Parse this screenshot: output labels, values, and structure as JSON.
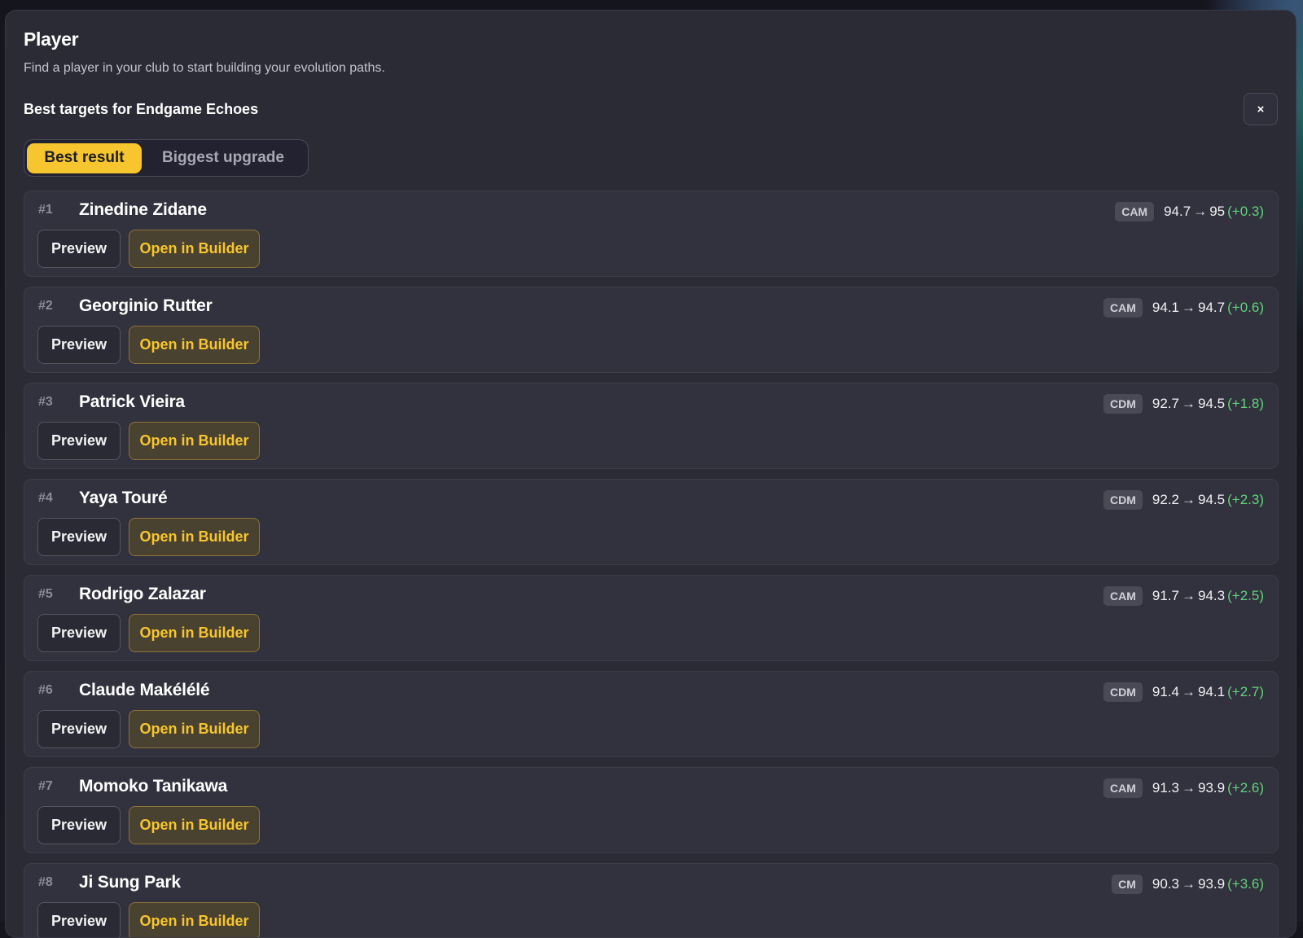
{
  "header": {
    "title": "Player",
    "subtitle": "Find a player in your club to start building your evolution paths.",
    "section_heading": "Best targets for Endgame Echoes",
    "close_label": "×"
  },
  "toggle": {
    "options": [
      "Best result",
      "Biggest upgrade"
    ],
    "selected": "Best result"
  },
  "actions": {
    "preview_label": "Preview",
    "builder_label": "Open in Builder",
    "arrow_glyph": "→"
  },
  "colors": {
    "accent": "#f7c52e",
    "delta_positive": "#5fd37a",
    "panel": "#2b2b36"
  },
  "players": [
    {
      "rank": "#1",
      "name": "Zinedine Zidane",
      "position": "CAM",
      "from": "94.7",
      "to": "95",
      "delta": "(+0.3)"
    },
    {
      "rank": "#2",
      "name": "Georginio Rutter",
      "position": "CAM",
      "from": "94.1",
      "to": "94.7",
      "delta": "(+0.6)"
    },
    {
      "rank": "#3",
      "name": "Patrick Vieira",
      "position": "CDM",
      "from": "92.7",
      "to": "94.5",
      "delta": "(+1.8)"
    },
    {
      "rank": "#4",
      "name": "Yaya Touré",
      "position": "CDM",
      "from": "92.2",
      "to": "94.5",
      "delta": "(+2.3)"
    },
    {
      "rank": "#5",
      "name": "Rodrigo Zalazar",
      "position": "CAM",
      "from": "91.7",
      "to": "94.3",
      "delta": "(+2.5)"
    },
    {
      "rank": "#6",
      "name": "Claude Makélélé",
      "position": "CDM",
      "from": "91.4",
      "to": "94.1",
      "delta": "(+2.7)"
    },
    {
      "rank": "#7",
      "name": "Momoko Tanikawa",
      "position": "CAM",
      "from": "91.3",
      "to": "93.9",
      "delta": "(+2.6)"
    },
    {
      "rank": "#8",
      "name": "Ji Sung Park",
      "position": "CM",
      "from": "90.3",
      "to": "93.9",
      "delta": "(+3.6)"
    }
  ]
}
